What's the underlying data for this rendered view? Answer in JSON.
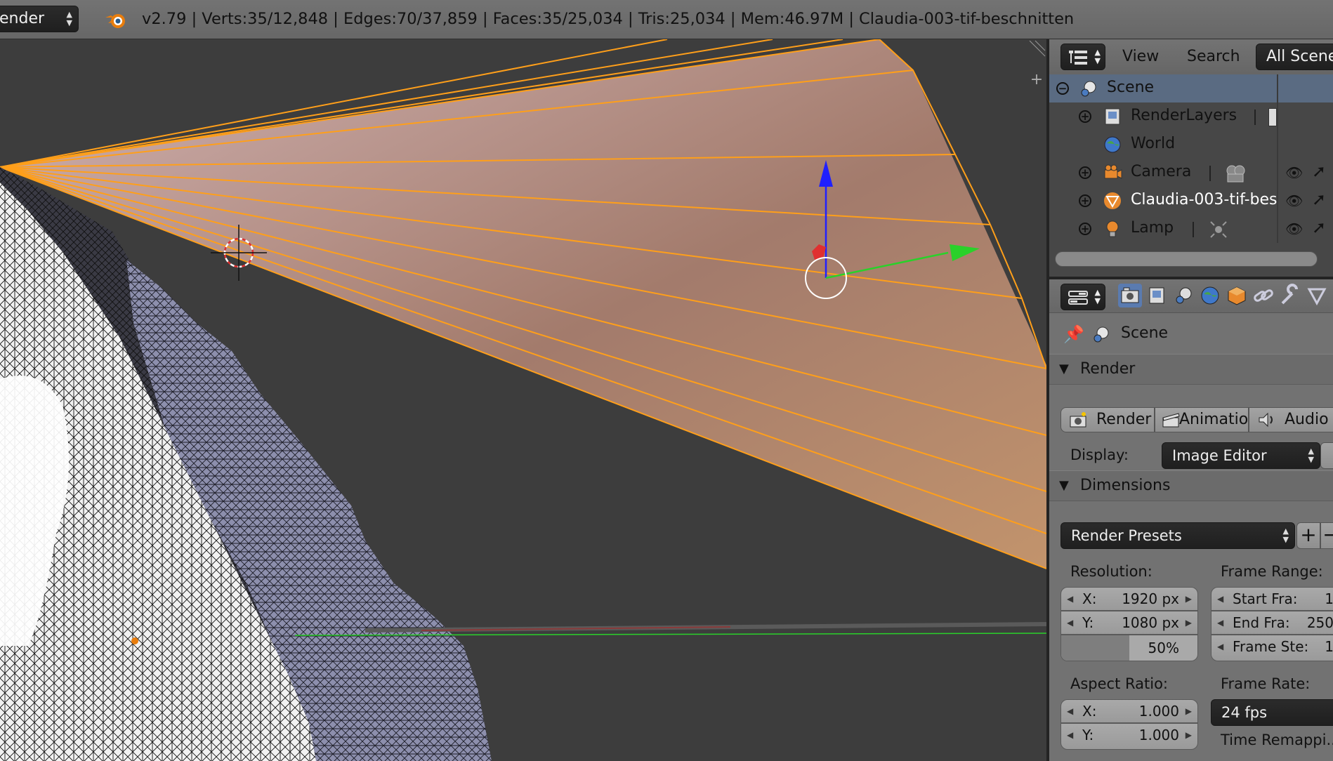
{
  "header": {
    "engine": "ender",
    "stats": "v2.79 | Verts:35/12,848 | Edges:70/37,859 | Faces:35/25,034 | Tris:25,034 | Mem:46.97M | Claudia-003-tif-beschnitten",
    "logo": "blender-logo-icon"
  },
  "outliner": {
    "menus": {
      "view": "View",
      "search": "Search",
      "display": "All Scene"
    },
    "rows": [
      {
        "label": "Scene",
        "icon": "scene-icon"
      },
      {
        "label": "RenderLayers",
        "icon": "render-layers-icon"
      },
      {
        "label": "World",
        "icon": "world-icon"
      },
      {
        "label": "Camera",
        "icon": "camera-icon"
      },
      {
        "label": "Claudia-003-tif-bes",
        "icon": "mesh-icon"
      },
      {
        "label": "Lamp",
        "icon": "lamp-icon"
      }
    ]
  },
  "properties": {
    "context": "Scene",
    "render_panel": {
      "title": "Render",
      "buttons": {
        "render": "Render",
        "animation": "Animatio",
        "audio": "Audio"
      },
      "display_label": "Display:",
      "display_value": "Image Editor"
    },
    "dimensions_panel": {
      "title": "Dimensions",
      "presets": "Render Presets",
      "resolution_label": "Resolution:",
      "res_x_label": "X:",
      "res_x": "1920 px",
      "res_y_label": "Y:",
      "res_y": "1080 px",
      "res_percent": "50%",
      "res_percent_value": 0.5,
      "frame_range_label": "Frame Range:",
      "start_label": "Start Fra:",
      "start": "1",
      "end_label": "End Fra:",
      "end": "250",
      "step_label": "Frame Ste:",
      "step": "1",
      "aspect_label": "Aspect Ratio:",
      "aspect_x_label": "X:",
      "aspect_x": "1.000",
      "aspect_y_label": "Y:",
      "aspect_y": "1.000",
      "frame_rate_label": "Frame Rate:",
      "frame_rate": "24 fps",
      "time_remap_label": "Time Remappi..."
    }
  },
  "colors": {
    "selection_orange": "#ff9f1a",
    "axis_x": "#e03030",
    "axis_y": "#2ad12a",
    "axis_z": "#2020ff"
  }
}
